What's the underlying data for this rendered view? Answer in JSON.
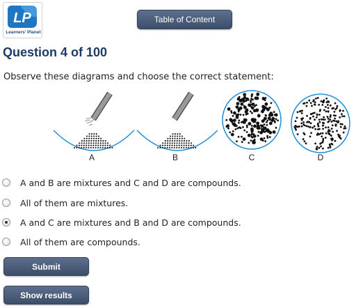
{
  "header": {
    "logo_mark": "LP",
    "logo_text": "Learners' Planet",
    "toc_label": "Table of Content"
  },
  "question": {
    "title": "Question 4 of 100",
    "prompt": "Observe these diagrams and choose the correct statement:"
  },
  "diagram": {
    "labels": [
      "A",
      "B",
      "C",
      "D"
    ],
    "colors": {
      "bowl": "#1e8bd6",
      "rod": "#7a7a7a",
      "particle": "#111111"
    }
  },
  "options": [
    {
      "label": "A and B are mixtures and C and D are compounds.",
      "selected": false
    },
    {
      "label": "All of them are mixtures.",
      "selected": false
    },
    {
      "label": "A and C are mixtures and B and D are compounds.",
      "selected": true
    },
    {
      "label": "All of them are compounds.",
      "selected": false
    }
  ],
  "actions": {
    "submit_label": "Submit",
    "results_label": "Show results"
  },
  "theme": {
    "button": "#4a5a78",
    "title": "#1b3a66",
    "logo": "#1f77c4"
  }
}
